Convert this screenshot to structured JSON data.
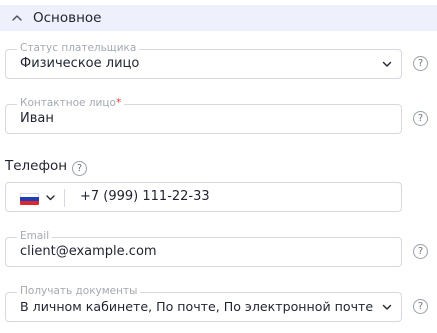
{
  "section": {
    "title": "Основное",
    "collapse_icon": "chevron-up-icon"
  },
  "payer_status": {
    "label": "Статус плательщика",
    "value": "Физическое лицо"
  },
  "contact_person": {
    "label": "Контактное лицо",
    "required_mark": "*",
    "value": "Иван"
  },
  "phone": {
    "label": "Телефон",
    "country_flag": "russia-flag-icon",
    "value": "+7 (999) 111-22-33"
  },
  "email": {
    "label": "Email",
    "value": "client@example.com"
  },
  "documents": {
    "label": "Получать документы",
    "value": "В личном кабинете, По почте, По электронной почте"
  },
  "help_mark": "?",
  "colors": {
    "header_bg": "#eef1fb",
    "border": "#d6d9e0",
    "required": "#e53935",
    "legend": "#a4a9b3"
  }
}
